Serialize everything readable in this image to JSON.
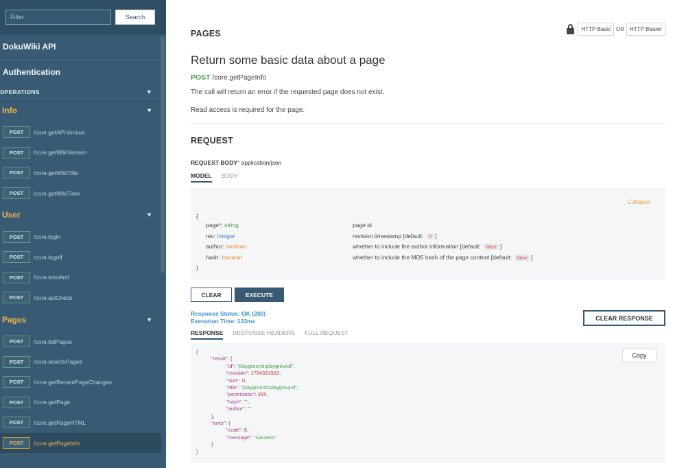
{
  "sidebar": {
    "filter_placeholder": "Filter",
    "search_label": "Search",
    "links": [
      "DokuWiki API",
      "Authentication"
    ],
    "operations_label": "OPERATIONS",
    "groups": [
      {
        "name": "Info",
        "ops": [
          {
            "method": "POST",
            "path": "/core.getAPIVersion"
          },
          {
            "method": "POST",
            "path": "/core.getWikiVersion"
          },
          {
            "method": "POST",
            "path": "/core.getWikiTitle"
          },
          {
            "method": "POST",
            "path": "/core.getWikiTime"
          }
        ]
      },
      {
        "name": "User",
        "ops": [
          {
            "method": "POST",
            "path": "/core.login"
          },
          {
            "method": "POST",
            "path": "/core.logoff"
          },
          {
            "method": "POST",
            "path": "/core.whoAmI"
          },
          {
            "method": "POST",
            "path": "/core.aclCheck"
          }
        ]
      },
      {
        "name": "Pages",
        "ops": [
          {
            "method": "POST",
            "path": "/core.listPages"
          },
          {
            "method": "POST",
            "path": "/core.searchPages"
          },
          {
            "method": "POST",
            "path": "/core.getRecentPageChanges"
          },
          {
            "method": "POST",
            "path": "/core.getPage"
          },
          {
            "method": "POST",
            "path": "/core.getPageHTML"
          },
          {
            "method": "POST",
            "path": "/core.getPageInfo"
          }
        ]
      }
    ]
  },
  "main": {
    "section": "PAGES",
    "auth": {
      "basic": "HTTP Basic",
      "or": "OR",
      "bearer": "HTTP Bearer"
    },
    "summary": "Return some basic data about a page",
    "method": "POST",
    "path": "/core.getPageInfo",
    "desc1": "The call will return an error if the requested page does not exist.",
    "desc2": "Read access is required for the page.",
    "request_title": "REQUEST",
    "request_body_label": "REQUEST BODY",
    "required_mark": "*",
    "content_type": "application/json",
    "tabs": [
      "MODEL",
      "BODY"
    ],
    "collapse": "Collapse",
    "brace_open": "{",
    "brace_close": "}",
    "model_rows": [
      {
        "name": "page",
        "req": "*",
        "sep": ": ",
        "type": "string",
        "desc": "page id",
        "default": ""
      },
      {
        "name": "rev",
        "req": "",
        "sep": ": ",
        "type": "integer",
        "desc": "revision timestamp [default: ",
        "default": "0"
      },
      {
        "name": "author",
        "req": "",
        "sep": ": ",
        "type": "boolean",
        "desc": "whether to include the author information [default: ",
        "default": "false"
      },
      {
        "name": "hash",
        "req": "",
        "sep": ": ",
        "type": "boolean",
        "desc": "whether to include the MD5 hash of the page content [default: ",
        "default": "false"
      }
    ],
    "close_bracket": "]",
    "clear_label": "CLEAR",
    "execute_label": "EXECUTE",
    "status_line1": "Response Status: OK (200)",
    "status_line2": "Execution Time: 133ms",
    "clear_response_label": "CLEAR RESPONSE",
    "response_tabs": [
      "RESPONSE",
      "RESPONSE HEADERS",
      "FULL REQUEST"
    ],
    "copy_label": "Copy",
    "response_lines": [
      {
        "indent": 0,
        "text": "{"
      },
      {
        "indent": 1,
        "key": "\"result\"",
        "rest": ": {"
      },
      {
        "indent": 2,
        "key": "\"id\"",
        "sep": ": ",
        "val": "\"playground:playground\"",
        "kind": "s",
        "tail": ","
      },
      {
        "indent": 2,
        "key": "\"revision\"",
        "sep": ": ",
        "val": "1704391993",
        "kind": "n",
        "tail": ","
      },
      {
        "indent": 2,
        "key": "\"size\"",
        "sep": ": ",
        "val": "0",
        "kind": "n",
        "tail": ","
      },
      {
        "indent": 2,
        "key": "\"title\"",
        "sep": ": ",
        "val": "\"playground:playground\"",
        "kind": "s",
        "tail": ","
      },
      {
        "indent": 2,
        "key": "\"permission\"",
        "sep": ": ",
        "val": "255",
        "kind": "n",
        "tail": ","
      },
      {
        "indent": 2,
        "key": "\"hash\"",
        "sep": ": ",
        "val": "\"\"",
        "kind": "s",
        "tail": ","
      },
      {
        "indent": 2,
        "key": "\"author\"",
        "sep": ": ",
        "val": "\"\"",
        "kind": "s",
        "tail": ""
      },
      {
        "indent": 1,
        "text": "},"
      },
      {
        "indent": 1,
        "key": "\"error\"",
        "rest": ": {"
      },
      {
        "indent": 2,
        "key": "\"code\"",
        "sep": ": ",
        "val": "0",
        "kind": "n",
        "tail": ","
      },
      {
        "indent": 2,
        "key": "\"message\"",
        "sep": ": ",
        "val": "\"success\"",
        "kind": "s",
        "tail": ""
      },
      {
        "indent": 1,
        "text": "}"
      },
      {
        "indent": 0,
        "text": "}"
      }
    ]
  }
}
